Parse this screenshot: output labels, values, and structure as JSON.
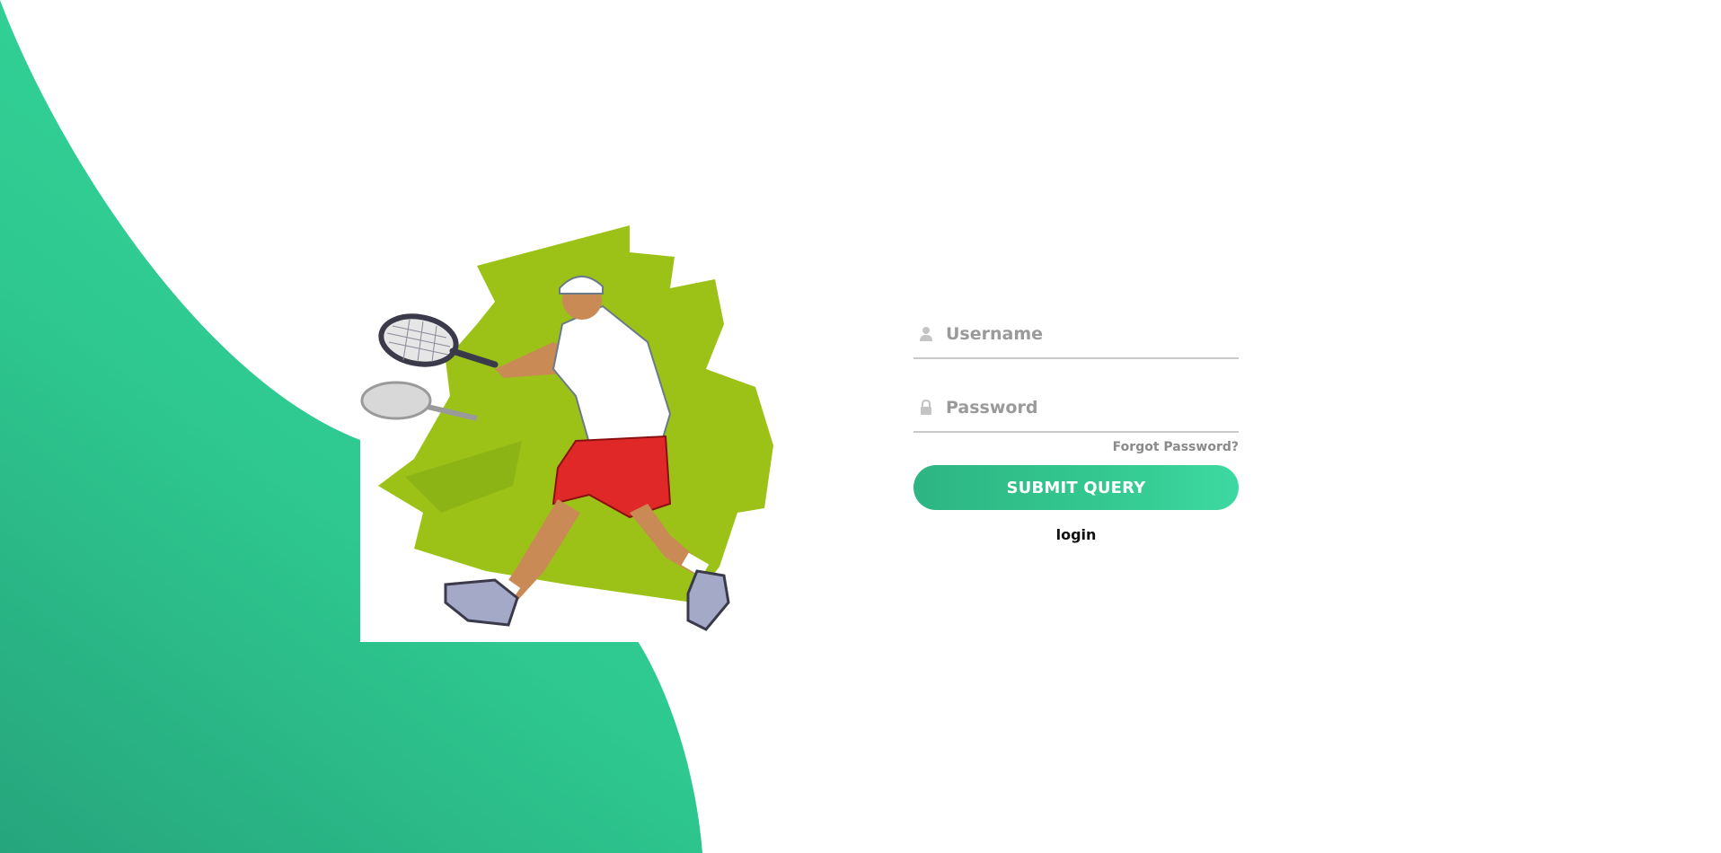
{
  "login_form": {
    "username": {
      "value": "",
      "placeholder": "Username",
      "icon": "user-icon"
    },
    "password": {
      "value": "",
      "placeholder": "Password",
      "icon": "lock-icon"
    },
    "forgot_label": "Forgot Password?",
    "submit_label": "SUBMIT QUERY",
    "login_label": "login"
  },
  "colors": {
    "accent": "#2fcf95",
    "accent_dark": "#27a87a",
    "field_border": "#c9c9c9",
    "placeholder": "#9a9a9a"
  },
  "hero": {
    "icon": "tennis-player-illustration"
  }
}
